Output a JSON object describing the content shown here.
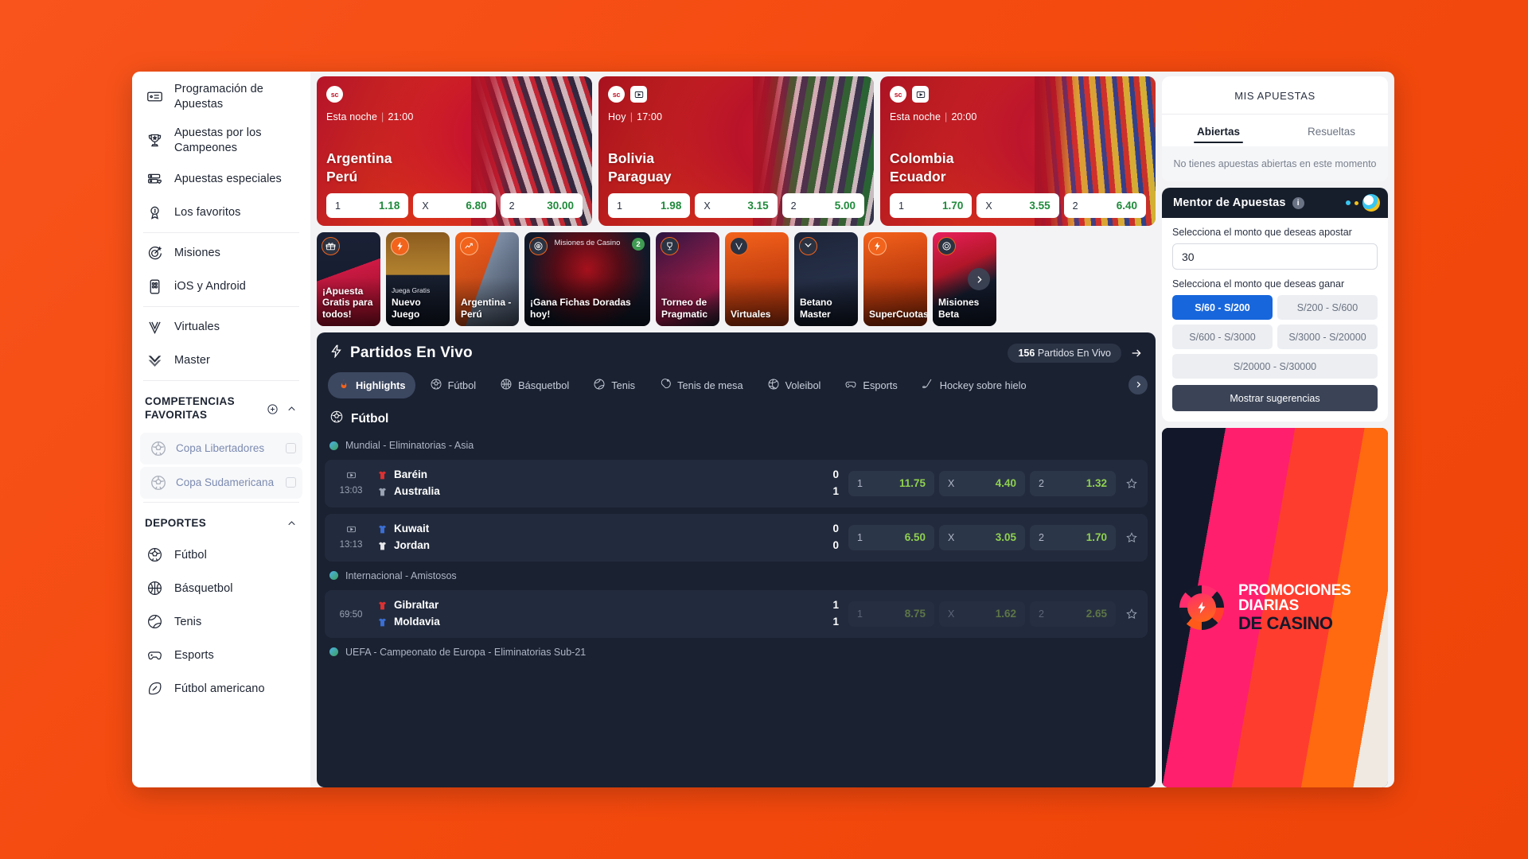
{
  "sidebar": {
    "nav": [
      {
        "label": "Programación de Apuestas",
        "icon": "ticket-icon"
      },
      {
        "label": "Apuestas por los Campeones",
        "icon": "trophy-icon"
      },
      {
        "label": "Apuestas especiales",
        "icon": "special-bets-icon"
      },
      {
        "label": "Los favoritos",
        "icon": "medal-icon"
      },
      {
        "label": "Misiones",
        "icon": "target-icon"
      },
      {
        "label": "iOS y Android",
        "icon": "mobile-icon"
      },
      {
        "label": "Virtuales",
        "icon": "virtuals-v-icon"
      },
      {
        "label": "Master",
        "icon": "master-icon"
      }
    ],
    "favorites_title": "COMPETENCIAS FAVORITAS",
    "favorites": [
      {
        "label": "Copa Libertadores"
      },
      {
        "label": "Copa Sudamericana"
      }
    ],
    "sports_title": "DEPORTES",
    "sports": [
      {
        "label": "Fútbol",
        "icon": "football-icon"
      },
      {
        "label": "Básquetbol",
        "icon": "basketball-icon"
      },
      {
        "label": "Tenis",
        "icon": "tennis-icon"
      },
      {
        "label": "Esports",
        "icon": "esports-icon"
      },
      {
        "label": "Fútbol americano",
        "icon": "american-football-icon"
      }
    ]
  },
  "hero_cards": [
    {
      "badges": [
        "sc"
      ],
      "day": "Esta noche",
      "time": "21:00",
      "home": "Argentina",
      "away": "Perú",
      "odds": [
        {
          "key": "1",
          "value": "1.18"
        },
        {
          "key": "X",
          "value": "6.80"
        },
        {
          "key": "2",
          "value": "30.00"
        }
      ]
    },
    {
      "badges": [
        "sc",
        "play"
      ],
      "day": "Hoy",
      "time": "17:00",
      "home": "Bolivia",
      "away": "Paraguay",
      "odds": [
        {
          "key": "1",
          "value": "1.98"
        },
        {
          "key": "X",
          "value": "3.15"
        },
        {
          "key": "2",
          "value": "5.00"
        }
      ]
    },
    {
      "badges": [
        "sc",
        "play"
      ],
      "day": "Esta noche",
      "time": "20:00",
      "home": "Colombia",
      "away": "Ecuador",
      "odds": [
        {
          "key": "1",
          "value": "1.70"
        },
        {
          "key": "X",
          "value": "3.55"
        },
        {
          "key": "2",
          "value": "6.40"
        }
      ]
    }
  ],
  "promo_tiles": [
    {
      "label": "¡Apuesta Gratis para todos!",
      "icon": "gift-icon",
      "sub": "",
      "head": "",
      "count": ""
    },
    {
      "label": "Nuevo Juego",
      "icon": "betano-b-icon",
      "sub": "Juega Gratis",
      "head": "",
      "count": ""
    },
    {
      "label": "Argentina - Perú",
      "icon": "boost-icon",
      "sub": "",
      "head": "",
      "count": ""
    },
    {
      "label": "¡Gana Fichas Doradas hoy!",
      "icon": "target-icon",
      "sub": "",
      "head": "Misiones de Casino",
      "count": "2"
    },
    {
      "label": "Torneo de Pragmatic",
      "icon": "trophy-icon",
      "sub": "",
      "head": "",
      "count": ""
    },
    {
      "label": "Virtuales",
      "icon": "virtuals-v-icon",
      "sub": "",
      "head": "",
      "count": ""
    },
    {
      "label": "Betano Master",
      "icon": "master-icon",
      "sub": "",
      "head": "",
      "count": ""
    },
    {
      "label": "SuperCuotas",
      "icon": "betano-b-icon",
      "sub": "",
      "head": "",
      "count": ""
    },
    {
      "label": "Misiones Beta",
      "icon": "target-icon",
      "sub": "",
      "head": "",
      "count": ""
    }
  ],
  "live": {
    "title": "Partidos En Vivo",
    "count": "156",
    "count_label": "Partidos En Vivo",
    "tabs": [
      {
        "label": "Highlights",
        "icon": "flame-icon",
        "active": true
      },
      {
        "label": "Fútbol",
        "icon": "football-icon",
        "active": false
      },
      {
        "label": "Básquetbol",
        "icon": "basketball-icon",
        "active": false
      },
      {
        "label": "Tenis",
        "icon": "tennis-icon",
        "active": false
      },
      {
        "label": "Tenis de mesa",
        "icon": "table-tennis-icon",
        "active": false
      },
      {
        "label": "Voleibol",
        "icon": "volleyball-icon",
        "active": false
      },
      {
        "label": "Esports",
        "icon": "esports-icon",
        "active": false
      },
      {
        "label": "Hockey sobre hielo",
        "icon": "ice-hockey-icon",
        "active": false
      }
    ],
    "sport_section": "Fútbol",
    "groups": [
      {
        "league": "Mundial - Eliminatorias - Asia",
        "matches": [
          {
            "time": "13:03",
            "home": "Baréin",
            "away": "Australia",
            "home_score": "0",
            "away_score": "1",
            "home_color": "#e03030",
            "away_color": "#9aa3b4",
            "dim": false,
            "odds": [
              {
                "key": "1",
                "value": "11.75"
              },
              {
                "key": "X",
                "value": "4.40"
              },
              {
                "key": "2",
                "value": "1.32"
              }
            ]
          },
          {
            "time": "13:13",
            "home": "Kuwait",
            "away": "Jordan",
            "home_score": "0",
            "away_score": "0",
            "home_color": "#3b6fd4",
            "away_color": "#e8e8ea",
            "dim": false,
            "odds": [
              {
                "key": "1",
                "value": "6.50"
              },
              {
                "key": "X",
                "value": "3.05"
              },
              {
                "key": "2",
                "value": "1.70"
              }
            ]
          }
        ]
      },
      {
        "league": "Internacional - Amistosos",
        "matches": [
          {
            "time": "69:50",
            "home": "Gibraltar",
            "away": "Moldavia",
            "home_score": "1",
            "away_score": "1",
            "home_color": "#e03030",
            "away_color": "#3b6fd4",
            "dim": true,
            "odds": [
              {
                "key": "1",
                "value": "8.75"
              },
              {
                "key": "X",
                "value": "1.62"
              },
              {
                "key": "2",
                "value": "2.65"
              }
            ]
          }
        ]
      },
      {
        "league": "UEFA - Campeonato de Europa - Eliminatorias Sub-21",
        "matches": []
      }
    ]
  },
  "mybets": {
    "title": "MIS APUESTAS",
    "tabs": [
      {
        "label": "Abiertas",
        "active": true
      },
      {
        "label": "Resueltas",
        "active": false
      }
    ],
    "empty": "No tienes apuestas abiertas en este momento"
  },
  "mentor": {
    "title": "Mentor de Apuestas",
    "info_icon": "info-icon",
    "stake_label": "Selecciona el monto que deseas apostar",
    "stake_value": "30",
    "win_label": "Selecciona el monto que deseas ganar",
    "ranges": [
      {
        "label": "S/60 - S/200",
        "selected": true,
        "full": false
      },
      {
        "label": "S/200 - S/600",
        "selected": false,
        "full": false
      },
      {
        "label": "S/600 - S/3000",
        "selected": false,
        "full": false
      },
      {
        "label": "S/3000 - S/20000",
        "selected": false,
        "full": false
      },
      {
        "label": "S/20000 - S/30000",
        "selected": false,
        "full": true
      }
    ],
    "button": "Mostrar sugerencias"
  },
  "promo_banner": {
    "line1": "PROMOCIONES",
    "line2": "DIARIAS",
    "line3": "DE CASINO",
    "icon": "casino-chip-icon"
  },
  "colors": {
    "page_bg": "#f44b10",
    "panel_dark": "#1a2131",
    "odds_green": "#1f8a3b",
    "live_green": "#8fd14f",
    "accent_blue": "#1766dc"
  }
}
